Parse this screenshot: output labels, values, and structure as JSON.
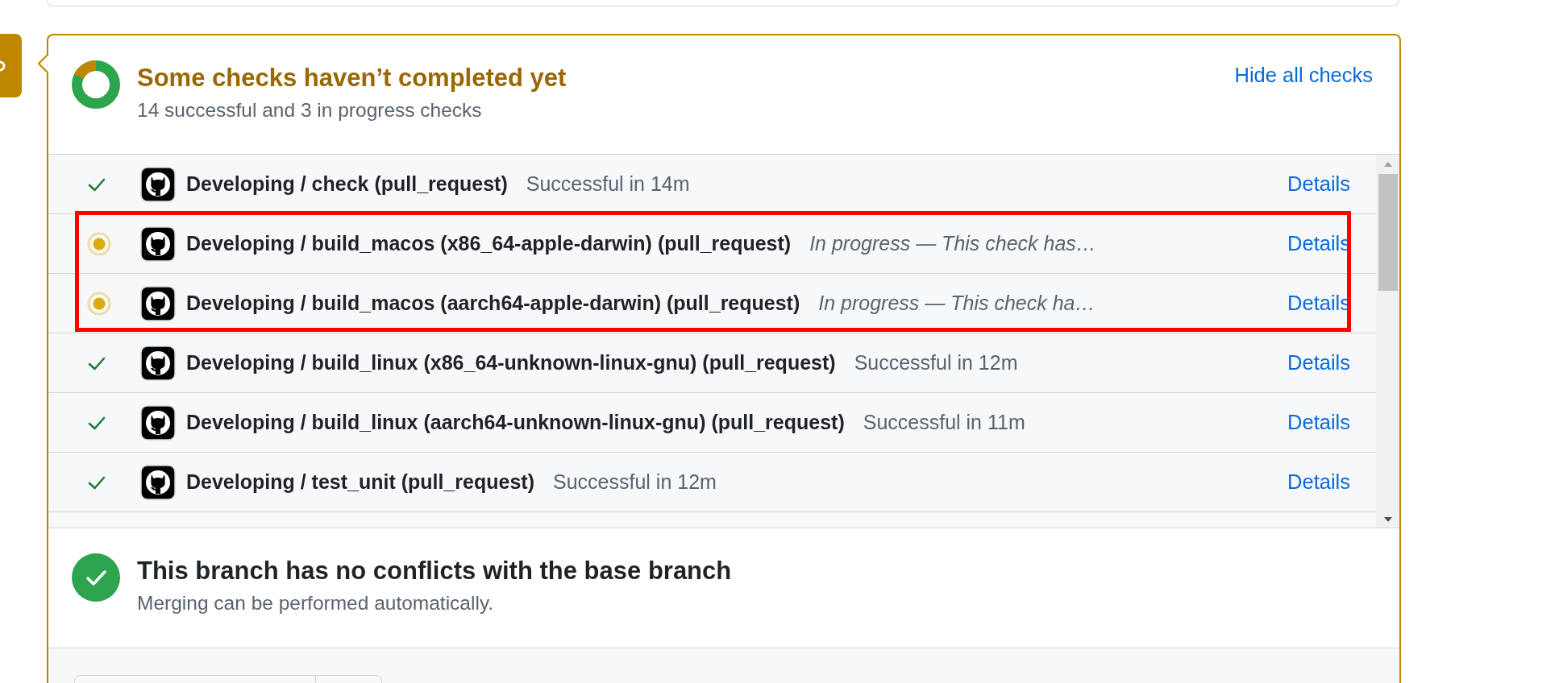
{
  "checks_summary": {
    "kind": "pending",
    "title": "Some checks haven’t completed yet",
    "subtitle": "14 successful and 3 in progress checks",
    "toggle_link": "Hide all checks"
  },
  "checks": [
    {
      "kind": "success",
      "highlighted": false,
      "name": "Developing / check (pull_request)",
      "description": "Successful in 14m",
      "link": "Details"
    },
    {
      "kind": "in_progress",
      "highlighted": true,
      "name": "Developing / build_macos (x86_64-apple-darwin) (pull_request)",
      "description": "In progress — This check has…",
      "link": "Details"
    },
    {
      "kind": "in_progress",
      "highlighted": true,
      "name": "Developing / build_macos (aarch64-apple-darwin) (pull_request)",
      "description": "In progress — This check ha…",
      "link": "Details"
    },
    {
      "kind": "success",
      "highlighted": false,
      "name": "Developing / build_linux (x86_64-unknown-linux-gnu) (pull_request)",
      "description": "Successful in 12m",
      "link": "Details"
    },
    {
      "kind": "success",
      "highlighted": false,
      "name": "Developing / build_linux (aarch64-unknown-linux-gnu) (pull_request)",
      "description": "Successful in 11m",
      "link": "Details"
    },
    {
      "kind": "success",
      "highlighted": false,
      "name": "Developing / test_unit (pull_request)",
      "description": "Successful in 12m",
      "link": "Details"
    }
  ],
  "merge_status": {
    "kind": "clean",
    "title": "This branch has no conflicts with the base branch",
    "subtitle": "Merging can be performed automatically."
  }
}
